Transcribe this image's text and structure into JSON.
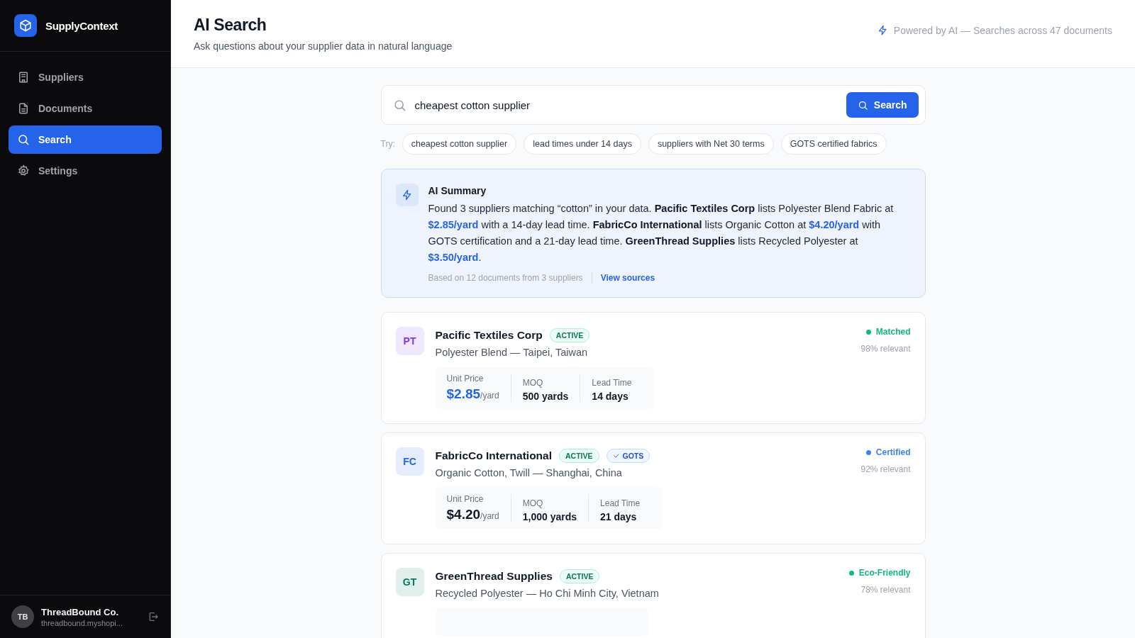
{
  "brand": {
    "name": "SupplyContext"
  },
  "sidebar": {
    "items": [
      {
        "label": "Suppliers",
        "kind": "building",
        "selected": false
      },
      {
        "label": "Documents",
        "kind": "file",
        "selected": false
      },
      {
        "label": "Search",
        "kind": "search",
        "selected": true
      },
      {
        "label": "Settings",
        "kind": "gear",
        "selected": false
      }
    ],
    "account": {
      "initials": "TB",
      "name": "ThreadBound Co.",
      "domain": "threadbound.myshopi..."
    }
  },
  "header": {
    "title": "AI Search",
    "subtitle": "Ask questions about your supplier data in natural language",
    "note": "Powered by AI — Searches across 47 documents"
  },
  "search": {
    "value": "cheapest cotton supplier",
    "button": "Search"
  },
  "suggestions": {
    "label": "Try:",
    "chips": [
      "cheapest cotton supplier",
      "lead times under 14 days",
      "suppliers with Net 30 terms",
      "GOTS certified fabrics"
    ]
  },
  "summary": {
    "title": "AI Summary",
    "segments": [
      {
        "kind": "plain",
        "text": "Found 3 suppliers matching “cotton” in your data. "
      },
      {
        "kind": "name",
        "text": "Pacific Textiles Corp"
      },
      {
        "kind": "plain",
        "text": " lists Polyester Blend Fabric at "
      },
      {
        "kind": "price",
        "text": "$2.85/yard"
      },
      {
        "kind": "plain",
        "text": " with a 14-day lead time. "
      },
      {
        "kind": "name",
        "text": "FabricCo International"
      },
      {
        "kind": "plain",
        "text": " lists Organic Cotton at "
      },
      {
        "kind": "price",
        "text": "$4.20/yard"
      },
      {
        "kind": "plain",
        "text": " with GOTS certification and a 21-day lead time. "
      },
      {
        "kind": "name",
        "text": "GreenThread Supplies"
      },
      {
        "kind": "plain",
        "text": " lists Recycled Polyester at "
      },
      {
        "kind": "price",
        "text": "$3.50/yard"
      },
      {
        "kind": "plain",
        "text": "."
      }
    ],
    "basis": "Based on 12 documents from 3 suppliers",
    "link": "View sources"
  },
  "results": [
    {
      "initials": "PT",
      "name": "Pacific Textiles Corp",
      "badges": [
        {
          "kind": "active",
          "text": "ACTIVE"
        }
      ],
      "detail": "Polyester Blend — Taipei, Taiwan",
      "status": "Matched",
      "color": "#10b981",
      "relevance": "98% relevant",
      "stats": {
        "price_label": "Unit Price",
        "price": "$2.85",
        "unit": "/yard",
        "best_price": true,
        "moq_label": "MOQ",
        "moq": "500 yards",
        "lead_label": "Lead Time",
        "lead": "14 days"
      }
    },
    {
      "initials": "FC",
      "name": "FabricCo International",
      "badges": [
        {
          "kind": "active",
          "text": "ACTIVE"
        },
        {
          "kind": "certified",
          "text": "GOTS"
        }
      ],
      "detail": "Organic Cotton, Twill — Shanghai, China",
      "status": "Certified",
      "color": "#3b82f6",
      "relevance": "92% relevant",
      "stats": {
        "price_label": "Unit Price",
        "price": "$4.20",
        "unit": "/yard",
        "best_price": false,
        "moq_label": "MOQ",
        "moq": "1,000 yards",
        "lead_label": "Lead Time",
        "lead": "21 days"
      }
    },
    {
      "initials": "GT",
      "name": "GreenThread Supplies",
      "badges": [
        {
          "kind": "active",
          "text": "ACTIVE"
        }
      ],
      "detail": "Recycled Polyester — Ho Chi Minh City, Vietnam",
      "status": "Eco-Friendly",
      "color": "#10b981",
      "relevance": "78% relevant"
    }
  ]
}
